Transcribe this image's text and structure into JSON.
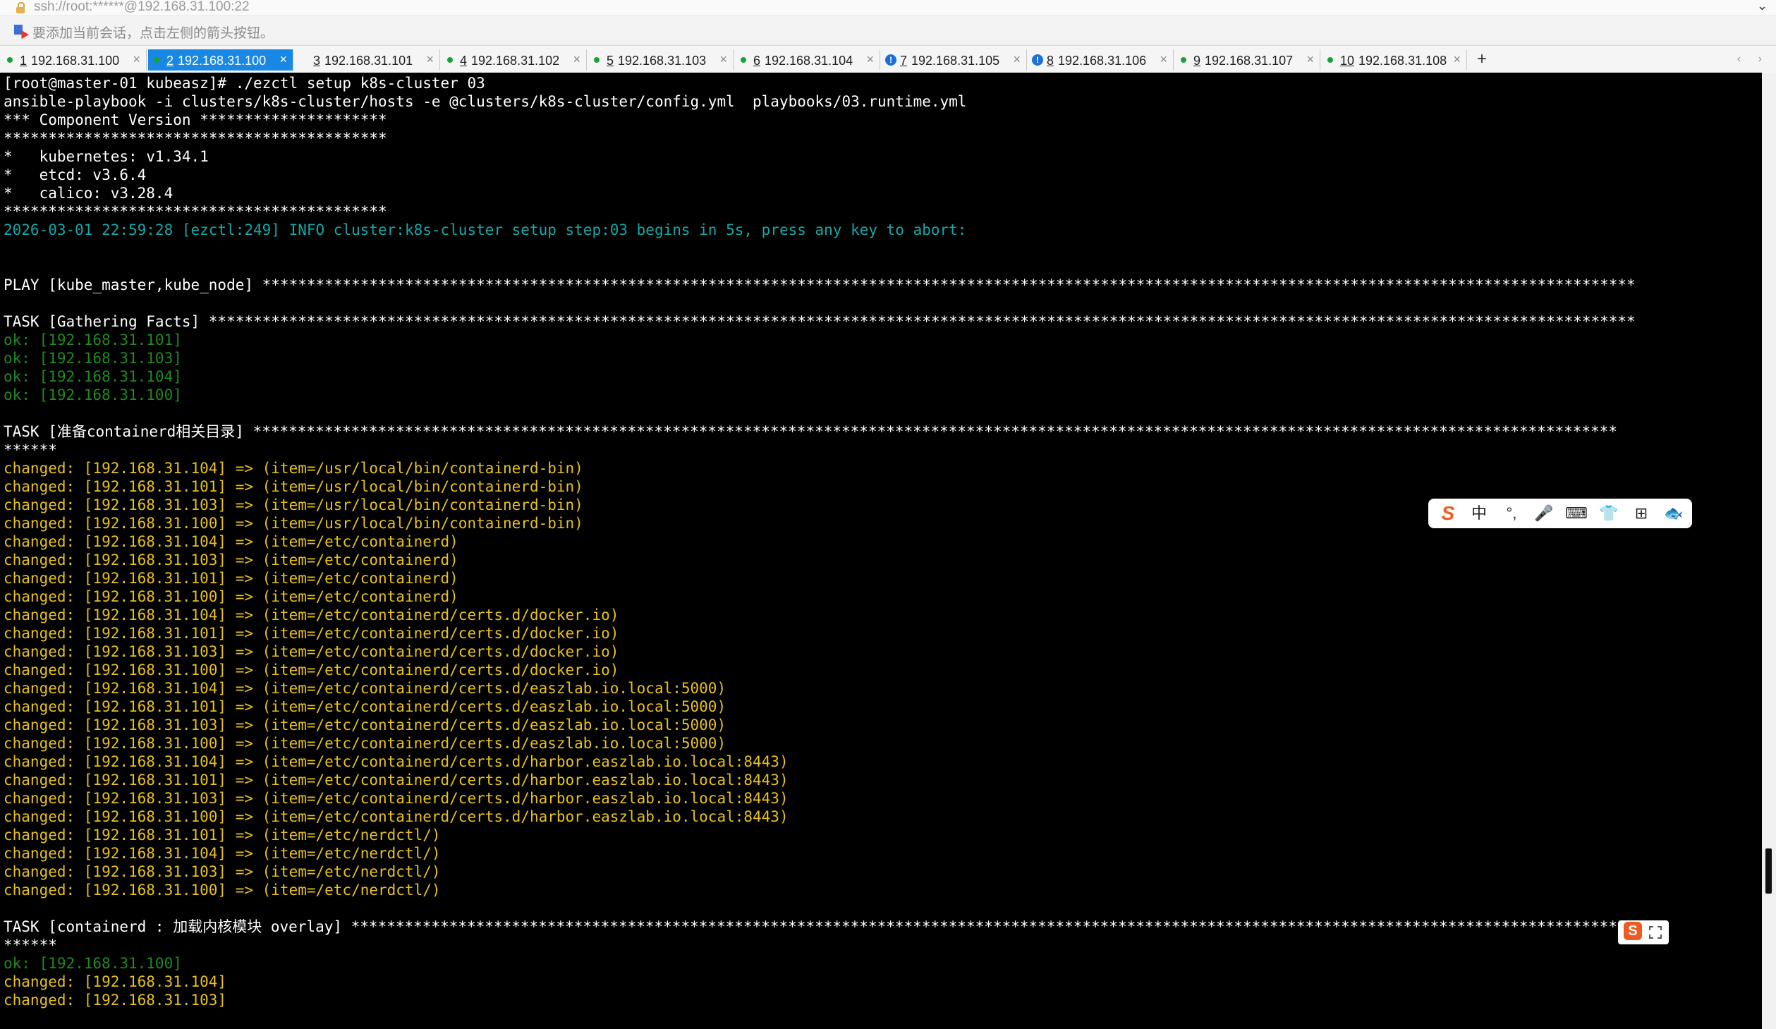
{
  "address": {
    "text": "ssh://root:******@192.168.31.100:22",
    "chevron": "⌄"
  },
  "hint": {
    "text": "要添加当前会话，点击左侧的箭头按钮。"
  },
  "tabs": [
    {
      "num": "1",
      "host": "192.168.31.100",
      "status": "dot",
      "active": false
    },
    {
      "num": "2",
      "host": "192.168.31.100",
      "status": "dot",
      "active": true
    },
    {
      "num": "3",
      "host": "192.168.31.101",
      "status": "none",
      "active": false
    },
    {
      "num": "4",
      "host": "192.168.31.102",
      "status": "dot",
      "active": false
    },
    {
      "num": "5",
      "host": "192.168.31.103",
      "status": "dot",
      "active": false
    },
    {
      "num": "6",
      "host": "192.168.31.104",
      "status": "dot",
      "active": false
    },
    {
      "num": "7",
      "host": "192.168.31.105",
      "status": "info",
      "active": false
    },
    {
      "num": "8",
      "host": "192.168.31.106",
      "status": "info",
      "active": false
    },
    {
      "num": "9",
      "host": "192.168.31.107",
      "status": "dot",
      "active": false
    },
    {
      "num": "10",
      "host": "192.168.31.108",
      "status": "dot",
      "active": false
    }
  ],
  "tab_close": "×",
  "tab_add": "+",
  "nav": "‹ ›",
  "colors": {
    "white": "#ffffff",
    "cyan": "#13a8a8",
    "green": "#1f8a1f",
    "yellow": "#e8c21a"
  },
  "terminal": [
    {
      "t": "[root@master-01 kubeasz]# ./ezctl setup k8s-cluster 03",
      "c": "white"
    },
    {
      "t": "ansible-playbook -i clusters/k8s-cluster/hosts -e @clusters/k8s-cluster/config.yml  playbooks/03.runtime.yml",
      "c": "white"
    },
    {
      "t": "*** Component Version *********************",
      "c": "white"
    },
    {
      "t": "*******************************************",
      "c": "white"
    },
    {
      "t": "*   kubernetes: v1.34.1",
      "c": "white"
    },
    {
      "t": "*   etcd: v3.6.4",
      "c": "white"
    },
    {
      "t": "*   calico: v3.28.4",
      "c": "white"
    },
    {
      "t": "*******************************************",
      "c": "white"
    },
    {
      "t": "2026-03-01 22:59:28 [ezctl:249] INFO cluster:k8s-cluster setup step:03 begins in 5s, press any key to abort:",
      "c": "cyan"
    },
    {
      "t": "",
      "c": "white"
    },
    {
      "t": "",
      "c": "white"
    },
    {
      "t": "PLAY [kube_master,kube_node] **********************************************************************************************************************************************************",
      "c": "white"
    },
    {
      "t": "",
      "c": "white"
    },
    {
      "t": "TASK [Gathering Facts] ****************************************************************************************************************************************************************",
      "c": "white"
    },
    {
      "t": "ok: [192.168.31.101]",
      "c": "green"
    },
    {
      "t": "ok: [192.168.31.103]",
      "c": "green"
    },
    {
      "t": "ok: [192.168.31.104]",
      "c": "green"
    },
    {
      "t": "ok: [192.168.31.100]",
      "c": "green"
    },
    {
      "t": "",
      "c": "white"
    },
    {
      "t": "TASK [准备containerd相关目录] *********************************************************************************************************************************************************",
      "c": "white"
    },
    {
      "t": "******",
      "c": "white"
    },
    {
      "t": "changed: [192.168.31.104] => (item=/usr/local/bin/containerd-bin)",
      "c": "yellow"
    },
    {
      "t": "changed: [192.168.31.101] => (item=/usr/local/bin/containerd-bin)",
      "c": "yellow"
    },
    {
      "t": "changed: [192.168.31.103] => (item=/usr/local/bin/containerd-bin)",
      "c": "yellow"
    },
    {
      "t": "changed: [192.168.31.100] => (item=/usr/local/bin/containerd-bin)",
      "c": "yellow"
    },
    {
      "t": "changed: [192.168.31.104] => (item=/etc/containerd)",
      "c": "yellow"
    },
    {
      "t": "changed: [192.168.31.103] => (item=/etc/containerd)",
      "c": "yellow"
    },
    {
      "t": "changed: [192.168.31.101] => (item=/etc/containerd)",
      "c": "yellow"
    },
    {
      "t": "changed: [192.168.31.100] => (item=/etc/containerd)",
      "c": "yellow"
    },
    {
      "t": "changed: [192.168.31.104] => (item=/etc/containerd/certs.d/docker.io)",
      "c": "yellow"
    },
    {
      "t": "changed: [192.168.31.101] => (item=/etc/containerd/certs.d/docker.io)",
      "c": "yellow"
    },
    {
      "t": "changed: [192.168.31.103] => (item=/etc/containerd/certs.d/docker.io)",
      "c": "yellow"
    },
    {
      "t": "changed: [192.168.31.100] => (item=/etc/containerd/certs.d/docker.io)",
      "c": "yellow"
    },
    {
      "t": "changed: [192.168.31.104] => (item=/etc/containerd/certs.d/easzlab.io.local:5000)",
      "c": "yellow"
    },
    {
      "t": "changed: [192.168.31.101] => (item=/etc/containerd/certs.d/easzlab.io.local:5000)",
      "c": "yellow"
    },
    {
      "t": "changed: [192.168.31.103] => (item=/etc/containerd/certs.d/easzlab.io.local:5000)",
      "c": "yellow"
    },
    {
      "t": "changed: [192.168.31.100] => (item=/etc/containerd/certs.d/easzlab.io.local:5000)",
      "c": "yellow"
    },
    {
      "t": "changed: [192.168.31.104] => (item=/etc/containerd/certs.d/harbor.easzlab.io.local:8443)",
      "c": "yellow"
    },
    {
      "t": "changed: [192.168.31.101] => (item=/etc/containerd/certs.d/harbor.easzlab.io.local:8443)",
      "c": "yellow"
    },
    {
      "t": "changed: [192.168.31.103] => (item=/etc/containerd/certs.d/harbor.easzlab.io.local:8443)",
      "c": "yellow"
    },
    {
      "t": "changed: [192.168.31.100] => (item=/etc/containerd/certs.d/harbor.easzlab.io.local:8443)",
      "c": "yellow"
    },
    {
      "t": "changed: [192.168.31.101] => (item=/etc/nerdctl/)",
      "c": "yellow"
    },
    {
      "t": "changed: [192.168.31.104] => (item=/etc/nerdctl/)",
      "c": "yellow"
    },
    {
      "t": "changed: [192.168.31.103] => (item=/etc/nerdctl/)",
      "c": "yellow"
    },
    {
      "t": "changed: [192.168.31.100] => (item=/etc/nerdctl/)",
      "c": "yellow"
    },
    {
      "t": "",
      "c": "white"
    },
    {
      "t": "TASK [containerd : 加载内核模块 overlay] **************************************************************************************************************************************************",
      "c": "white"
    },
    {
      "t": "******",
      "c": "white"
    },
    {
      "t": "ok: [192.168.31.100]",
      "c": "green"
    },
    {
      "t": "changed: [192.168.31.104]",
      "c": "yellow"
    },
    {
      "t": "changed: [192.168.31.103]",
      "c": "yellow"
    }
  ],
  "ime": {
    "logo": "S",
    "items": [
      "中",
      "°,",
      "🎤",
      "⌨",
      "👕",
      "⊞",
      "🐟"
    ]
  },
  "ime_mini": {
    "logo": "S"
  }
}
